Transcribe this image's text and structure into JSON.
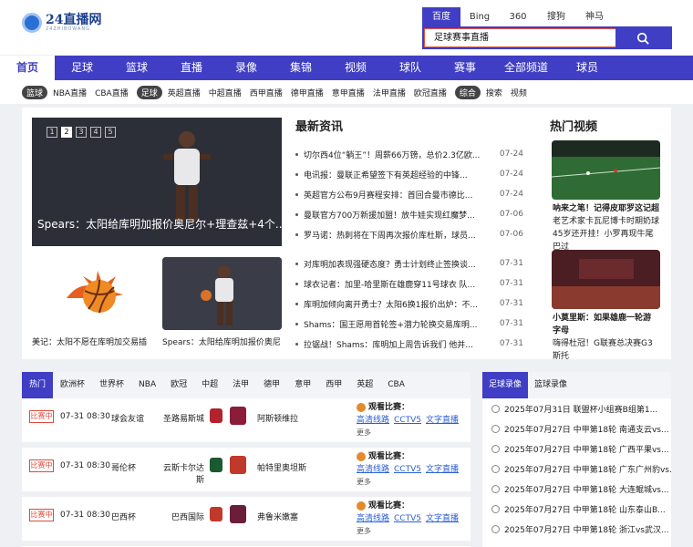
{
  "logo": {
    "main": "24直播网",
    "sub": "24ZHIBOWANG"
  },
  "search": {
    "engines": [
      "百度",
      "Bing",
      "360",
      "搜狗",
      "神马"
    ],
    "active_engine": 0,
    "query": "足球赛事直播"
  },
  "nav": [
    "首页",
    "足球",
    "篮球",
    "直播",
    "录像",
    "集锦",
    "视频",
    "球队",
    "赛事",
    "全部频道",
    "球员"
  ],
  "subnav": {
    "basketball_tag": "篮球",
    "basketball_links": [
      "NBA直播",
      "CBA直播"
    ],
    "football_tag": "足球",
    "football_links": [
      "英超直播",
      "中超直播",
      "西甲直播",
      "德甲直播",
      "意甲直播",
      "法甲直播",
      "欧冠直播"
    ],
    "misc_tag": "综合",
    "misc_links": [
      "搜索",
      "视频"
    ]
  },
  "slider": {
    "pages": [
      "1",
      "2",
      "3",
      "4",
      "5"
    ],
    "active_page": 1,
    "caption": "Spears：太阳给库明加报价奥尼尔+理查兹+4个..."
  },
  "thumbs": {
    "a_caption": "美记：太阳不愿在库明加交易插",
    "b_caption": "Spears：太阳给库明加报价奥尼"
  },
  "news": {
    "title": "最新资讯",
    "group1": [
      {
        "t": "切尔西4位“躺王”！周薪66万镑，总价2.3亿欧...",
        "d": "07-24"
      },
      {
        "t": "电讯报：曼联正希望签下有英超经验的中锋...",
        "d": "07-24"
      },
      {
        "t": "英超官方公布9月赛程安排：首回合曼市德比...",
        "d": "07-24"
      },
      {
        "t": "曼联官方700万新援加盟！放牛娃实现红魔梦...",
        "d": "07-06"
      },
      {
        "t": "罗马诺：热刺将在下周再次报价库杜斯，球员...",
        "d": "07-06"
      }
    ],
    "group2": [
      {
        "t": "对库明加表现强硬态度？勇士计划终止签换谈...",
        "d": "07-31"
      },
      {
        "t": "球衣记者：加里-哈里斯在雄鹿穿11号球衣 队...",
        "d": "07-31"
      },
      {
        "t": "库明加倾向离开勇士？太阳6换1报价出炉：不...",
        "d": "07-31"
      },
      {
        "t": "Shams：国王愿用首轮签+潜力轮换交易库明...",
        "d": "07-31"
      },
      {
        "t": "拉锯战！Shams：库明加上周告诉我们 他并...",
        "d": "07-31"
      }
    ]
  },
  "hot": {
    "title": "热门视频",
    "v1_title": "呐来之笔！记得皮耶罗这记超",
    "v1_desc": "老艺术家卡瓦尼博卡时期奶球45岁还开挂！小罗再现牛尾巴过",
    "v2_title": "小莫里斯：如果雄鹿一轮游 字母",
    "v2_desc": "嗨得杜冠！G联赛总决赛G3斯托"
  },
  "schedule": {
    "tabs": [
      "热门",
      "欧洲杯",
      "世界杯",
      "NBA",
      "欧冠",
      "中超",
      "法甲",
      "德甲",
      "意甲",
      "西甲",
      "英超",
      "CBA"
    ],
    "active_tab": 0,
    "watch_label": "观看比赛：",
    "link_labels": [
      "高清线路",
      "CCTV5",
      "文字直播"
    ],
    "more_label": "更多",
    "live_label": "比赛中",
    "matches": [
      {
        "time": "07-31 08:30",
        "league": "球会友谊",
        "home": "圣路易斯城",
        "away": "阿斯顿维拉",
        "c1": "#b2232e",
        "c2": "#8b1c3a"
      },
      {
        "time": "07-31 08:30",
        "league": "哥伦杯",
        "home": "云斯卡尔达斯",
        "away": "帕特里奥坦斯",
        "c1": "#1b5a2f",
        "c2": "#c0392b"
      },
      {
        "time": "07-31 08:30",
        "league": "巴西杯",
        "home": "巴西国际",
        "away": "弗鲁米嫩塞",
        "c1": "#c0392b",
        "c2": "#6b1e3a"
      }
    ]
  },
  "replays": {
    "tabs": [
      "足球录像",
      "篮球录像"
    ],
    "active_tab": 0,
    "rows": [
      "2025年07月31日 联盟杯小组赛B组第1...",
      "2025年07月27日 中甲第18轮 南通支云vs...",
      "2025年07月27日 中甲第18轮 广西平果vs...",
      "2025年07月27日 中甲第18轮 广东广州豹vs...",
      "2025年07月27日 中甲第18轮 大连鲲城vs...",
      "2025年07月27日 中甲第18轮 山东泰山B...",
      "2025年07月27日 中甲第18轮 浙江vs武汉..."
    ]
  }
}
